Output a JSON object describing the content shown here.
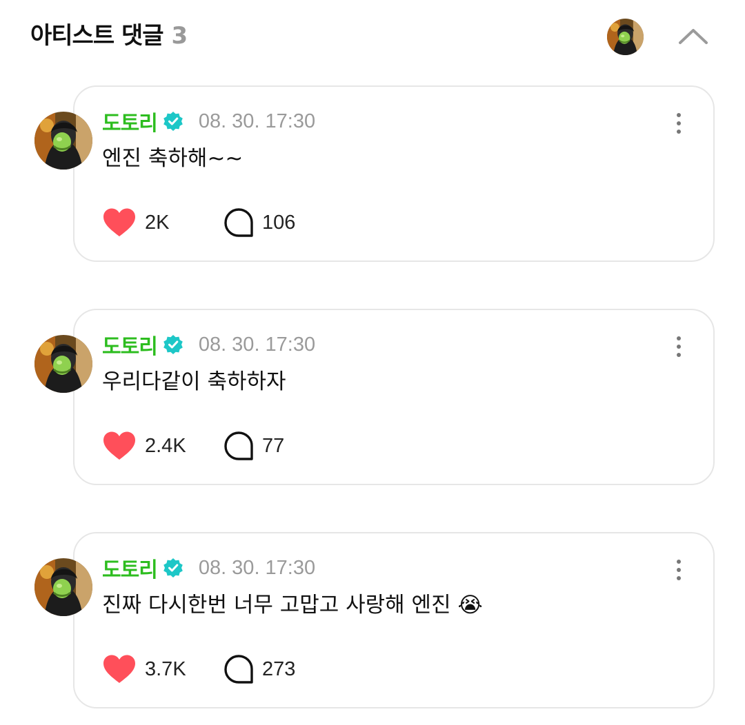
{
  "header": {
    "title": "아티스트 댓글",
    "count": "3"
  },
  "colors": {
    "name_green": "#2dbd1f",
    "verified_teal": "#1dc7c7",
    "heart_red": "#ff4f5a",
    "time_gray": "#9a9a9a",
    "card_border": "#e6e6e6"
  },
  "icons": {
    "collapse": "chevron-up-icon",
    "verified": "verified-badge-icon",
    "like": "heart-icon",
    "reply": "speech-bubble-icon",
    "more": "more-vertical-icon"
  },
  "comments": [
    {
      "author": "도토리",
      "time": "08. 30. 17:30",
      "text": "엔진 축하해~~",
      "likes": "2K",
      "replies": "106"
    },
    {
      "author": "도토리",
      "time": "08. 30. 17:30",
      "text": "우리다같이 축하하자",
      "likes": "2.4K",
      "replies": "77"
    },
    {
      "author": "도토리",
      "time": "08. 30. 17:30",
      "text": "진짜 다시한번 너무 고맙고 사랑해 엔진 😭",
      "likes": "3.7K",
      "replies": "273"
    }
  ]
}
